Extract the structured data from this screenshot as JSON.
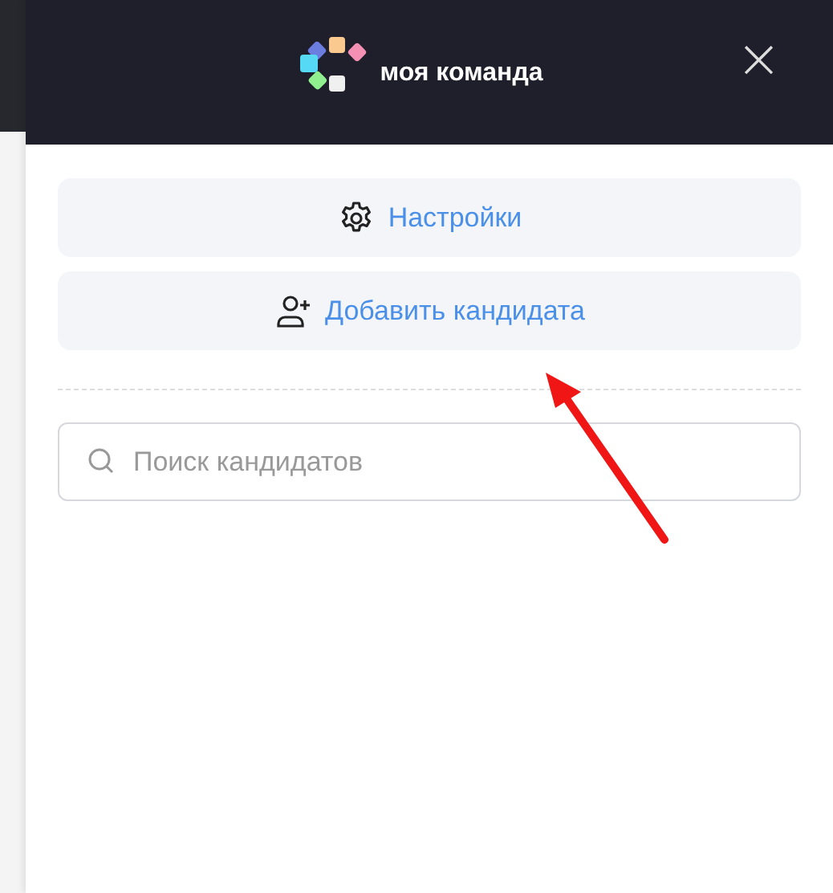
{
  "header": {
    "logo_text": "моя команда",
    "close": "×"
  },
  "buttons": [
    {
      "label": "Настройки",
      "kind": "settings"
    },
    {
      "label": "Добавить кандидата",
      "kind": "add-person"
    }
  ],
  "search": {
    "placeholder": "Поиск кандидатов"
  }
}
